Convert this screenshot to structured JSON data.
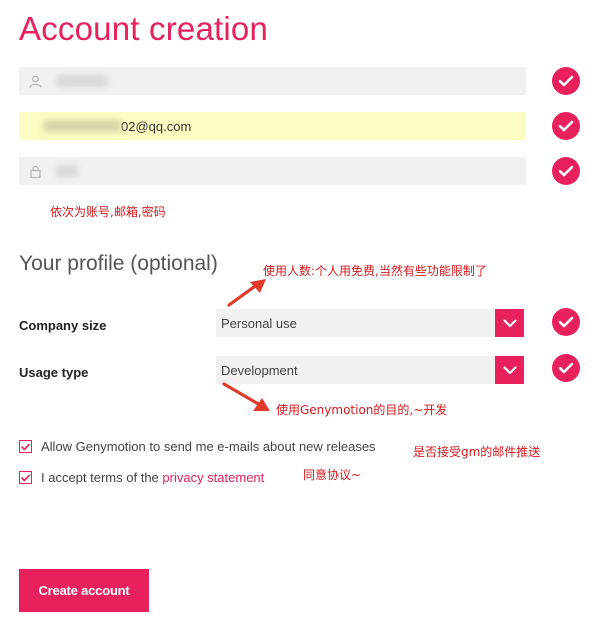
{
  "form": {
    "title": "Account creation",
    "username_value": "",
    "email_value": "02@qq.com",
    "password_value": ""
  },
  "profile": {
    "title": "Your profile (optional)",
    "company_size_label": "Company size",
    "company_size_value": "Personal use",
    "usage_type_label": "Usage type",
    "usage_type_value": "Development"
  },
  "consent": {
    "newsletter_label": "Allow Genymotion to send me e-mails about new releases",
    "newsletter_checked": true,
    "terms_prefix": "I accept terms of the ",
    "terms_link": "privacy statement",
    "terms_checked": true
  },
  "actions": {
    "create_label": "Create account"
  },
  "annotations": {
    "fields_note": "依次为账号,邮箱,密码",
    "company_note": "使用人数:个人用免费,当然有些功能限制了",
    "usage_note": "使用Genymotion的目的,~开发",
    "newsletter_note": "是否接受gm的邮件推送",
    "terms_note": "同意协议~"
  },
  "colors": {
    "accent": "#e8215d",
    "annotation": "#d7191c",
    "autofill": "#fafcc1",
    "field_bg": "#f1f1f1"
  },
  "icons": {
    "username": "user-icon",
    "password": "lock-icon",
    "valid": "check-icon",
    "dropdown": "chevron-down-icon"
  }
}
